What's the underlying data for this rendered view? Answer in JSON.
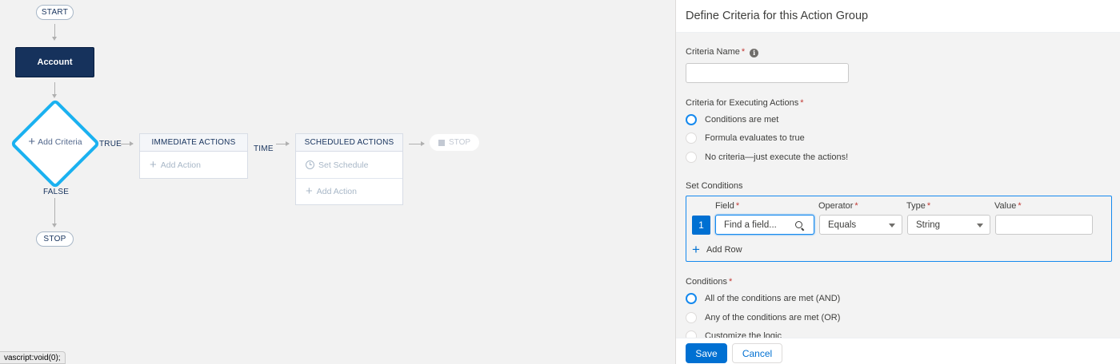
{
  "canvas": {
    "start_label": "START",
    "object_label": "Account",
    "criteria_label": "Add Criteria",
    "true_label": "TRUE",
    "false_label": "FALSE",
    "stop_label": "STOP",
    "time_label": "TIME",
    "immediate": {
      "header": "IMMEDIATE ACTIONS",
      "add_action": "Add Action"
    },
    "scheduled": {
      "header": "SCHEDULED ACTIONS",
      "set_schedule": "Set Schedule",
      "add_action": "Add Action"
    },
    "ghost_stop_label": "STOP",
    "status_url": "vascript:void(0);"
  },
  "panel": {
    "title": "Define Criteria for this Action Group",
    "criteria_name": {
      "label": "Criteria Name",
      "value": ""
    },
    "executing": {
      "label": "Criteria for Executing Actions",
      "options": [
        "Conditions are met",
        "Formula evaluates to true",
        "No criteria—just execute the actions!"
      ],
      "selected_index": 0
    },
    "set_conditions": {
      "label": "Set Conditions",
      "columns": {
        "field": "Field",
        "operator": "Operator",
        "type": "Type",
        "value": "Value"
      },
      "rows": [
        {
          "number": "1",
          "field_placeholder": "Find a field...",
          "operator": "Equals",
          "type": "String",
          "value": ""
        }
      ],
      "add_row_label": "Add Row"
    },
    "conditions": {
      "label": "Conditions",
      "options": [
        "All of the conditions are met (AND)",
        "Any of the conditions are met (OR)",
        "Customize the logic"
      ],
      "selected_index": 0
    },
    "footer": {
      "save_label": "Save",
      "cancel_label": "Cancel"
    }
  },
  "colors": {
    "brand": "#0070d2",
    "focus": "#1589ee",
    "required": "#c23934",
    "node_dark": "#16325c",
    "criteria_diamond": "#1ab1f0"
  }
}
